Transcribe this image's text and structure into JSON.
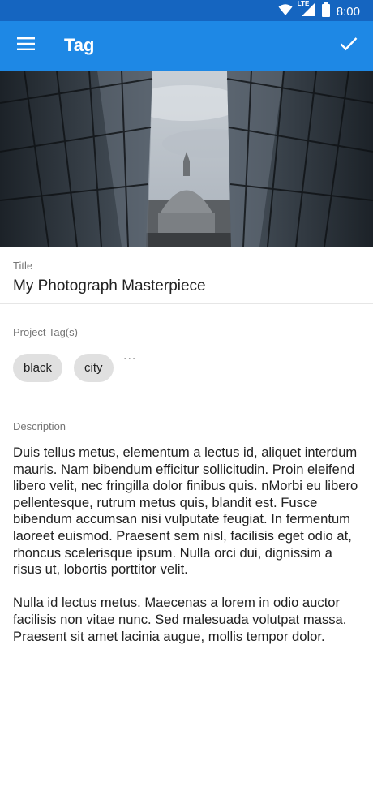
{
  "status_bar": {
    "time": "8:00",
    "network_label": "LTE",
    "icons": [
      "wifi-icon",
      "signal-icon",
      "battery-icon"
    ]
  },
  "app_bar": {
    "title": "Tag",
    "menu_icon": "hamburger-menu-icon",
    "confirm_icon": "check-icon"
  },
  "hero_image": {
    "description_icon": "photo-cathedral-between-glass-buildings"
  },
  "title_field": {
    "label": "Title",
    "value": "My Photograph Masterpiece"
  },
  "tags_field": {
    "label": "Project Tag(s)",
    "tags": [
      "black",
      "city"
    ],
    "more": "..."
  },
  "description_field": {
    "label": "Description",
    "paragraphs": [
      "Duis tellus metus, elementum a lectus id, aliquet interdum mauris. Nam bibendum efficitur sollicitudin. Proin eleifend libero velit, nec fringilla dolor finibus quis. nMorbi eu libero pellentesque, rutrum metus quis, blandit est. Fusce bibendum accumsan nisi vulputate feugiat. In fermentum laoreet euismod. Praesent sem nisl, facilisis eget odio at, rhoncus scelerisque ipsum. Nulla orci dui, dignissim a risus ut, lobortis porttitor velit.",
      "Nulla id lectus metus. Maecenas a lorem in odio auctor facilisis non vitae nunc. Sed malesuada volutpat massa. Praesent sit amet lacinia augue, mollis tempor dolor."
    ]
  },
  "colors": {
    "status_bar": "#1565c0",
    "app_bar": "#1e88e5",
    "chip": "#e0e0e0",
    "label": "#757575"
  }
}
